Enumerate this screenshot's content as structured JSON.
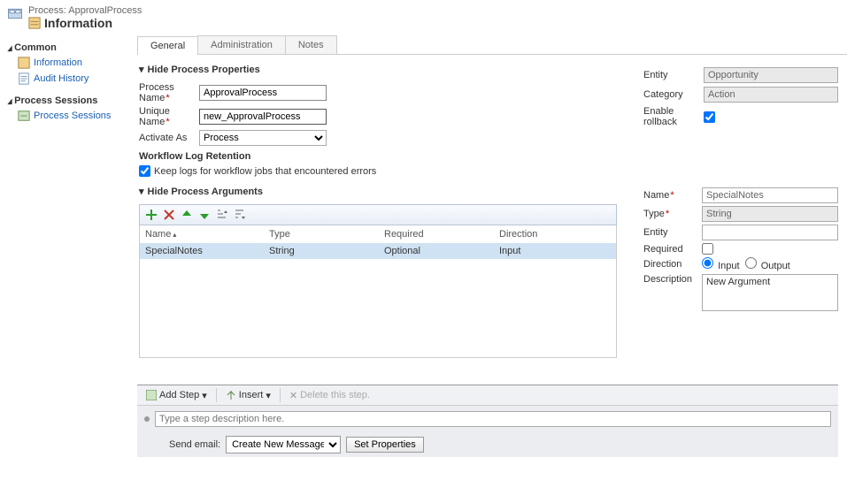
{
  "header": {
    "process_label": "Process: ApprovalProcess",
    "title": "Information"
  },
  "sidebar": {
    "group1": "Common",
    "items1": [
      "Information",
      "Audit History"
    ],
    "group2": "Process Sessions",
    "items2": [
      "Process Sessions"
    ]
  },
  "tabs": [
    "General",
    "Administration",
    "Notes"
  ],
  "section1": "Hide Process Properties",
  "process_name_label": "Process Name",
  "process_name_value": "ApprovalProcess",
  "unique_name_label": "Unique Name",
  "unique_name_value": "new_ApprovalProcess",
  "activate_as_label": "Activate As",
  "activate_as_value": "Process",
  "workflow_log_heading": "Workflow Log Retention",
  "keep_logs_label": "Keep logs for workflow jobs that encountered errors",
  "right_props": {
    "entity_label": "Entity",
    "entity_value": "Opportunity",
    "category_label": "Category",
    "category_value": "Action",
    "enable_rollback_label": "Enable rollback"
  },
  "section2": "Hide Process Arguments",
  "columns": {
    "c1": "Name",
    "c2": "Type",
    "c3": "Required",
    "c4": "Direction"
  },
  "argrows": [
    {
      "name": "SpecialNotes",
      "type": "String",
      "required": "Optional",
      "direction": "Input"
    }
  ],
  "arg_detail": {
    "name_label": "Name",
    "name_value": "SpecialNotes",
    "type_label": "Type",
    "type_value": "String",
    "entity_label": "Entity",
    "required_label": "Required",
    "direction_label": "Direction",
    "direction_input": "Input",
    "direction_output": "Output",
    "description_label": "Description",
    "description_value": "New Argument"
  },
  "steps": {
    "add_step": "Add Step",
    "insert": "Insert",
    "delete": "Delete this step.",
    "placeholder": "Type a step description here.",
    "send_email_label": "Send email:",
    "send_email_option": "Create New Message",
    "set_props": "Set Properties"
  }
}
